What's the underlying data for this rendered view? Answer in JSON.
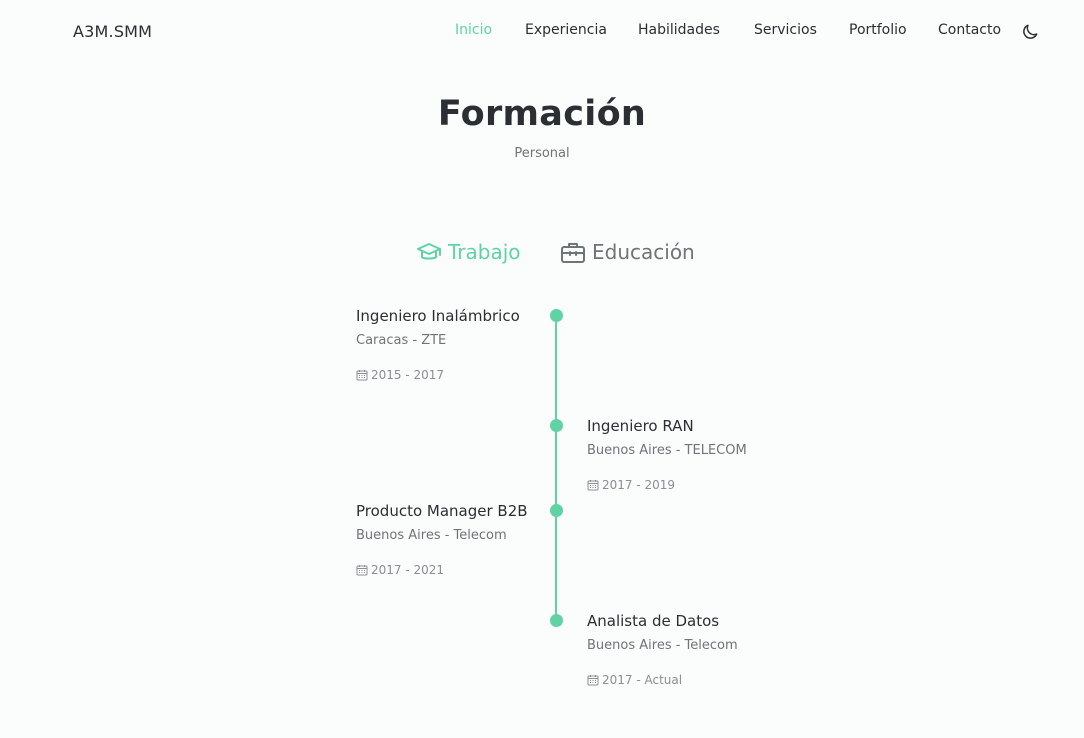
{
  "header": {
    "logo": "A3M.SMM",
    "nav": [
      "Inicio",
      "Experiencia",
      "Habilidades",
      "Servicios",
      "Portfolio",
      "Contacto"
    ],
    "active_nav": "Inicio",
    "theme_icon": "moon-icon"
  },
  "section": {
    "title": "Formación",
    "subtitle": "Personal"
  },
  "tabs": [
    {
      "label": "Trabajo",
      "icon": "graduation-cap-icon",
      "active": true
    },
    {
      "label": "Educación",
      "icon": "briefcase-icon",
      "active": false
    }
  ],
  "timeline": [
    {
      "title": "Ingeniero Inalámbrico",
      "subtitle": "Caracas - ZTE",
      "date": "2015 - 2017",
      "side": "left"
    },
    {
      "title": "Ingeniero RAN",
      "subtitle": "Buenos Aires - TELECOM",
      "date": "2017 - 2019",
      "side": "right"
    },
    {
      "title": "Producto Manager B2B",
      "subtitle": "Buenos Aires - Telecom",
      "date": "2017 - 2021",
      "side": "left"
    },
    {
      "title": "Analista de Datos",
      "subtitle": "Buenos Aires - Telecom",
      "date": "2017 - Actual",
      "side": "right"
    }
  ],
  "colors": {
    "accent": "#5fd3a3",
    "text": "#2b2f33",
    "muted": "#6f7478",
    "background": "#fbfcfc"
  }
}
